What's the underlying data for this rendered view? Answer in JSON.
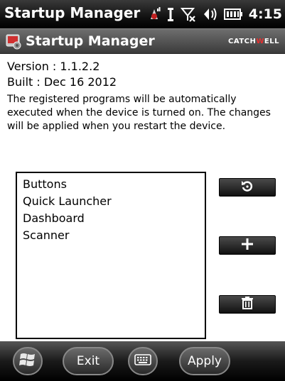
{
  "statusbar": {
    "title": "Startup Manager",
    "time": "4:15",
    "icons": [
      "data-activity-icon",
      "antenna-icon",
      "signal-off-icon",
      "speaker-icon",
      "battery-icon"
    ]
  },
  "header": {
    "title": "Startup Manager",
    "brand_left": "CATCH",
    "brand_w": "W",
    "brand_right": "ELL"
  },
  "main": {
    "version": "Version : 1.1.2.2",
    "built": "Built : Dec 16 2012",
    "description": "The registered programs will be automatically executed when the device is turned on. The changes will be applied when you restart the device.",
    "programs": [
      "Buttons",
      "Quick Launcher",
      "Dashboard",
      "Scanner"
    ]
  },
  "softkeys": {
    "left": "Exit",
    "right": "Apply"
  }
}
